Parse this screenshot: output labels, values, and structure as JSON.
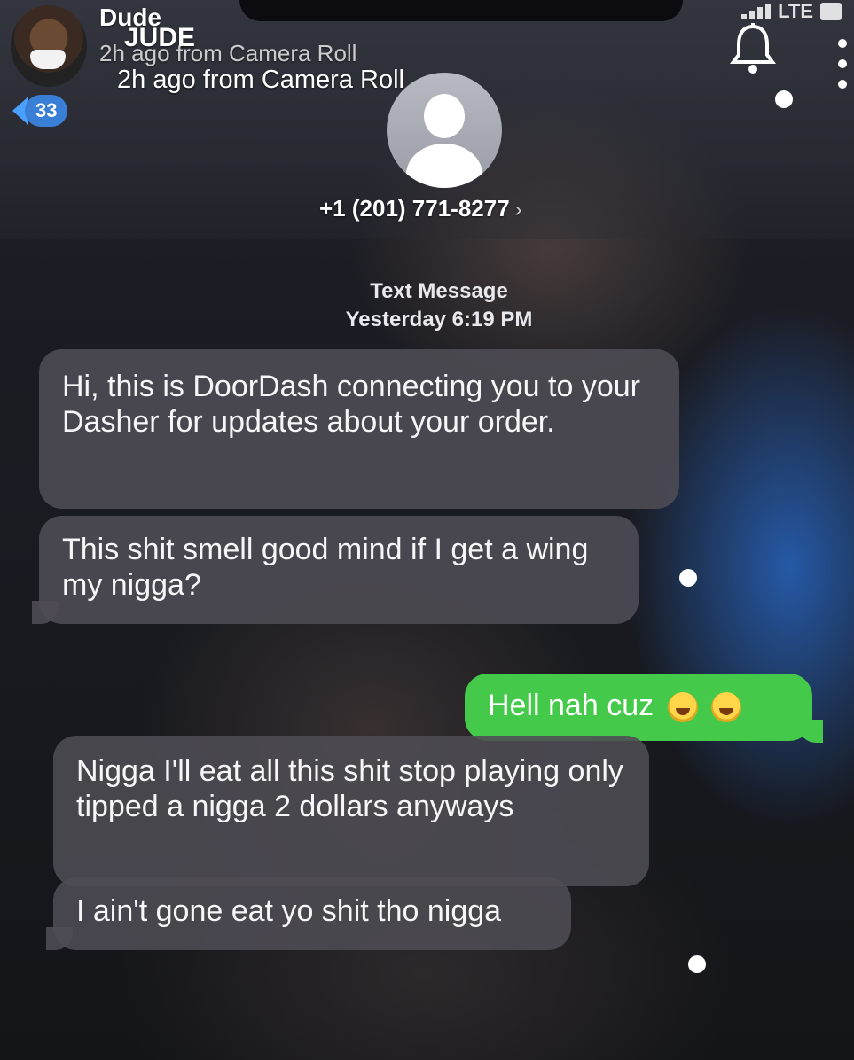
{
  "snapchat_header": {
    "name_top": "Dude",
    "name_overlay": "JUDE",
    "subtitle_top": "2h ago from Camera Roll",
    "subtitle": "2h ago from Camera Roll",
    "back_badge": "33"
  },
  "status_bar": {
    "network": "LTE"
  },
  "icons": {
    "back": "chevron-left-icon",
    "notify": "bell-icon",
    "more": "more-vertical-icon",
    "contact": "person-icon",
    "emoji": "face-with-tears-of-joy-emoji"
  },
  "contact": {
    "number": "+1 (201) 771-8277",
    "chevron": "›"
  },
  "thread": {
    "type_label": "Text Message",
    "timestamp": "Yesterday 6:19 PM"
  },
  "messages": [
    {
      "direction": "incoming",
      "text": "Hi, this is DoorDash connecting you to your Dasher for updates about your order."
    },
    {
      "direction": "incoming",
      "text": "This shit smell good mind if I get a wing my nigga?"
    },
    {
      "direction": "outgoing",
      "text": "Hell nah cuz",
      "emoji": [
        "😂",
        "😂"
      ]
    },
    {
      "direction": "incoming",
      "text": "Nigga I'll eat all this shit stop playing only tipped a nigga 2 dollars anyways"
    },
    {
      "direction": "incoming",
      "text": "I ain't gone eat yo shit tho nigga"
    }
  ],
  "colors": {
    "incoming_bubble": "#4e4c54",
    "outgoing_bubble": "#45c94a",
    "badge": "#3a7fd6"
  }
}
